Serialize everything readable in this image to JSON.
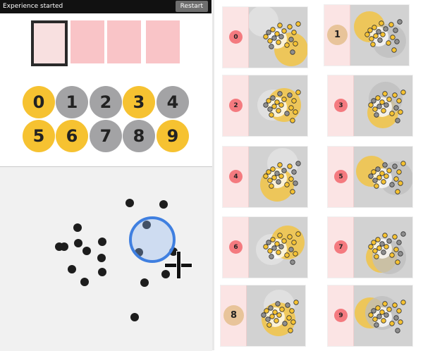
{
  "topbar": {
    "status": "Experience started",
    "restart_label": "Restart"
  },
  "slots": {
    "count": 4,
    "selected_index": 0
  },
  "digits": [
    {
      "label": "0",
      "color": "yellow"
    },
    {
      "label": "1",
      "color": "gray"
    },
    {
      "label": "2",
      "color": "gray"
    },
    {
      "label": "3",
      "color": "yellow"
    },
    {
      "label": "4",
      "color": "gray"
    },
    {
      "label": "5",
      "color": "yellow"
    },
    {
      "label": "6",
      "color": "yellow"
    },
    {
      "label": "7",
      "color": "gray"
    },
    {
      "label": "8",
      "color": "gray"
    },
    {
      "label": "9",
      "color": "yellow"
    }
  ],
  "panels": [
    {
      "label": "0",
      "highlight": false
    },
    {
      "label": "1",
      "highlight": true
    },
    {
      "label": "2",
      "highlight": false
    },
    {
      "label": "3",
      "highlight": false
    },
    {
      "label": "4",
      "highlight": false
    },
    {
      "label": "5",
      "highlight": false
    },
    {
      "label": "6",
      "highlight": false
    },
    {
      "label": "7",
      "highlight": false
    },
    {
      "label": "8",
      "highlight": true
    },
    {
      "label": "9",
      "highlight": false
    }
  ],
  "colors": {
    "yellow": "#f6c231",
    "gray": "#a3a3a5",
    "pink": "#f9c4c7",
    "badge": "#f47a7f",
    "cursor_ring": "#3f7fe0"
  },
  "cursor": {
    "icon": "crosshair-icon"
  }
}
